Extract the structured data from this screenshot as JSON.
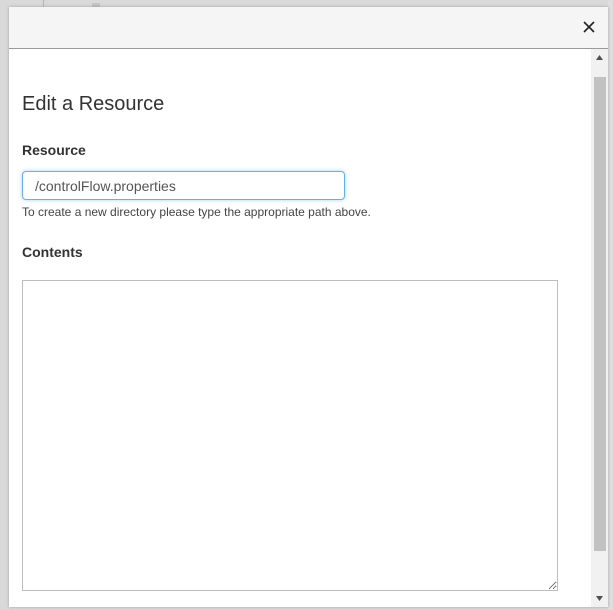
{
  "dialog": {
    "title": "Edit a Resource",
    "close_icon": "close-icon"
  },
  "form": {
    "resource_label": "Resource",
    "resource_value": "/controlFlow.properties",
    "resource_hint": "To create a new directory please type the appropriate path above.",
    "contents_label": "Contents",
    "contents_value": ""
  },
  "scrollbar": {
    "up_icon": "chevron-up-icon",
    "down_icon": "chevron-down-icon"
  },
  "colors": {
    "input_focus_border": "#66afe9",
    "header_background": "#f5f5f5",
    "text": "#333333"
  }
}
